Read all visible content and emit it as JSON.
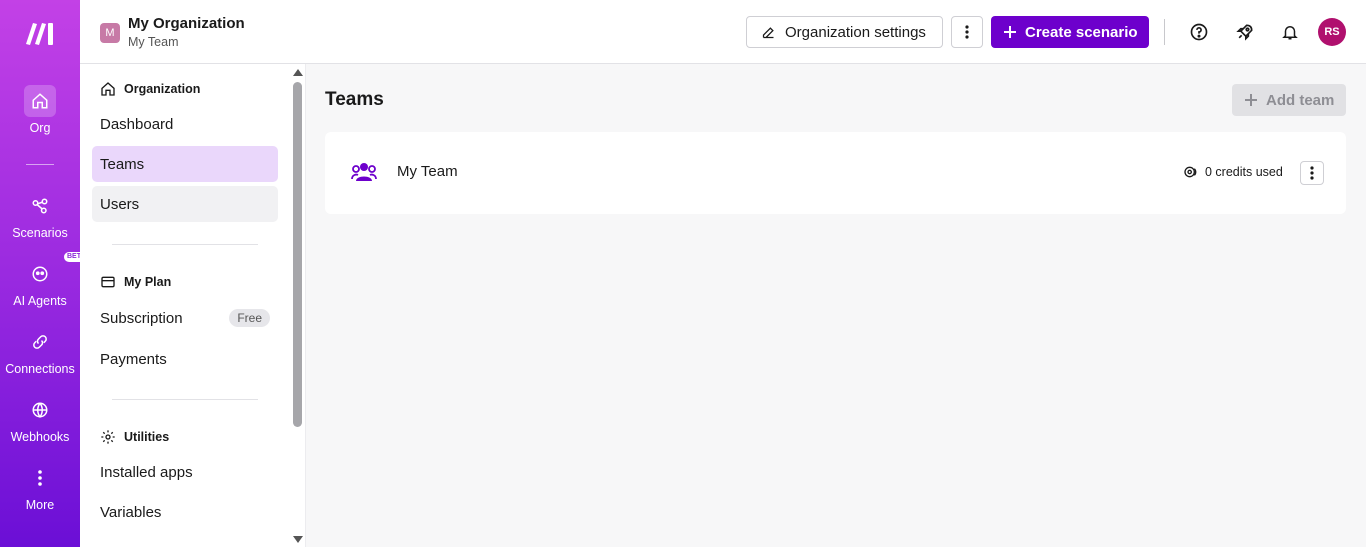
{
  "rail": {
    "items": [
      {
        "label": "Org",
        "icon": "home-icon"
      },
      {
        "label": "Scenarios",
        "icon": "share-icon"
      },
      {
        "label": "AI Agents",
        "icon": "ai-agent-icon",
        "badge": "BETA"
      },
      {
        "label": "Connections",
        "icon": "link-icon"
      },
      {
        "label": "Webhooks",
        "icon": "globe-icon"
      },
      {
        "label": "More",
        "icon": "more-vertical-icon"
      }
    ]
  },
  "header": {
    "org_initial": "M",
    "org_name": "My Organization",
    "team_name": "My Team",
    "org_settings_label": "Organization settings",
    "create_scenario_label": "Create scenario",
    "avatar_initials": "RS"
  },
  "sidenav": {
    "organization_title": "Organization",
    "org_items": [
      "Dashboard",
      "Teams",
      "Users"
    ],
    "plan_title": "My Plan",
    "plan_items": [
      "Subscription",
      "Payments"
    ],
    "subscription_badge": "Free",
    "utilities_title": "Utilities",
    "utility_items": [
      "Installed apps",
      "Variables"
    ]
  },
  "main": {
    "title": "Teams",
    "add_team_label": "Add team",
    "teams": [
      {
        "name": "My Team",
        "credits": "0 credits used"
      }
    ]
  },
  "colors": {
    "accent": "#6d00cc",
    "rail_top": "#c341e6",
    "rail_bottom": "#6b0fd6",
    "active_nav": "#ead7fb"
  }
}
